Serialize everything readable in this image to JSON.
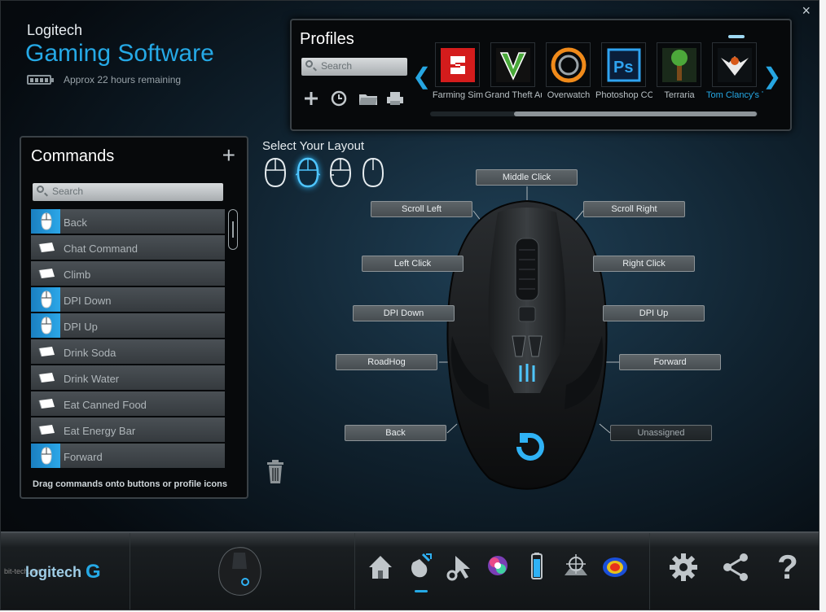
{
  "window": {
    "close_label": "×"
  },
  "brand": {
    "top": "Logitech",
    "main": "Gaming Software",
    "battery_text": "Approx 22 hours remaining"
  },
  "profiles": {
    "title": "Profiles",
    "search_placeholder": "Search",
    "tools": [
      "plus-icon",
      "clock-icon",
      "folder-icon",
      "printer-icon"
    ],
    "games": [
      {
        "name": "Farming Sim",
        "color": "#e02020"
      },
      {
        "name": "Grand Theft Auto",
        "color": "#3a8a2a"
      },
      {
        "name": "Overwatch",
        "color": "#f08a1a"
      },
      {
        "name": "Photoshop CC",
        "color": "#2fa3f0"
      },
      {
        "name": "Terraria",
        "color": "#4ca83a"
      },
      {
        "name": "Tom Clancy's The Division",
        "color": "#d85a1a",
        "active": true
      }
    ]
  },
  "commands": {
    "title": "Commands",
    "add_label": "+",
    "search_placeholder": "Search",
    "items": [
      {
        "label": "Back",
        "type": "mouse"
      },
      {
        "label": "Chat Command",
        "type": "key"
      },
      {
        "label": "Climb",
        "type": "key"
      },
      {
        "label": "DPI Down",
        "type": "mouse"
      },
      {
        "label": "DPI Up",
        "type": "mouse"
      },
      {
        "label": "Drink Soda",
        "type": "key"
      },
      {
        "label": "Drink Water",
        "type": "key"
      },
      {
        "label": "Eat Canned Food",
        "type": "key"
      },
      {
        "label": "Eat Energy Bar",
        "type": "key"
      },
      {
        "label": "Forward",
        "type": "mouse"
      }
    ],
    "hint": "Drag commands onto buttons or profile icons"
  },
  "layout": {
    "title": "Select Your Layout",
    "selected_index": 1
  },
  "buttons": {
    "middle_click": "Middle Click",
    "scroll_left": "Scroll Left",
    "scroll_right": "Scroll Right",
    "left_click": "Left Click",
    "right_click": "Right Click",
    "dpi_down": "DPI Down",
    "dpi_up": "DPI Up",
    "roadhog": "RoadHog",
    "forward": "Forward",
    "back": "Back",
    "unassigned": "Unassigned"
  },
  "bottom": {
    "logo": "logitech",
    "watermark": "bit-tech.net",
    "icons": [
      "home-icon",
      "customize-buttons-icon",
      "pointer-settings-icon",
      "lighting-icon",
      "battery-icon",
      "surface-tuning-icon",
      "heatmap-icon",
      "settings-gear-icon",
      "share-icon",
      "help-icon"
    ],
    "help_label": "?"
  },
  "colors": {
    "accent": "#25a9e6",
    "panel": "#07090b"
  }
}
